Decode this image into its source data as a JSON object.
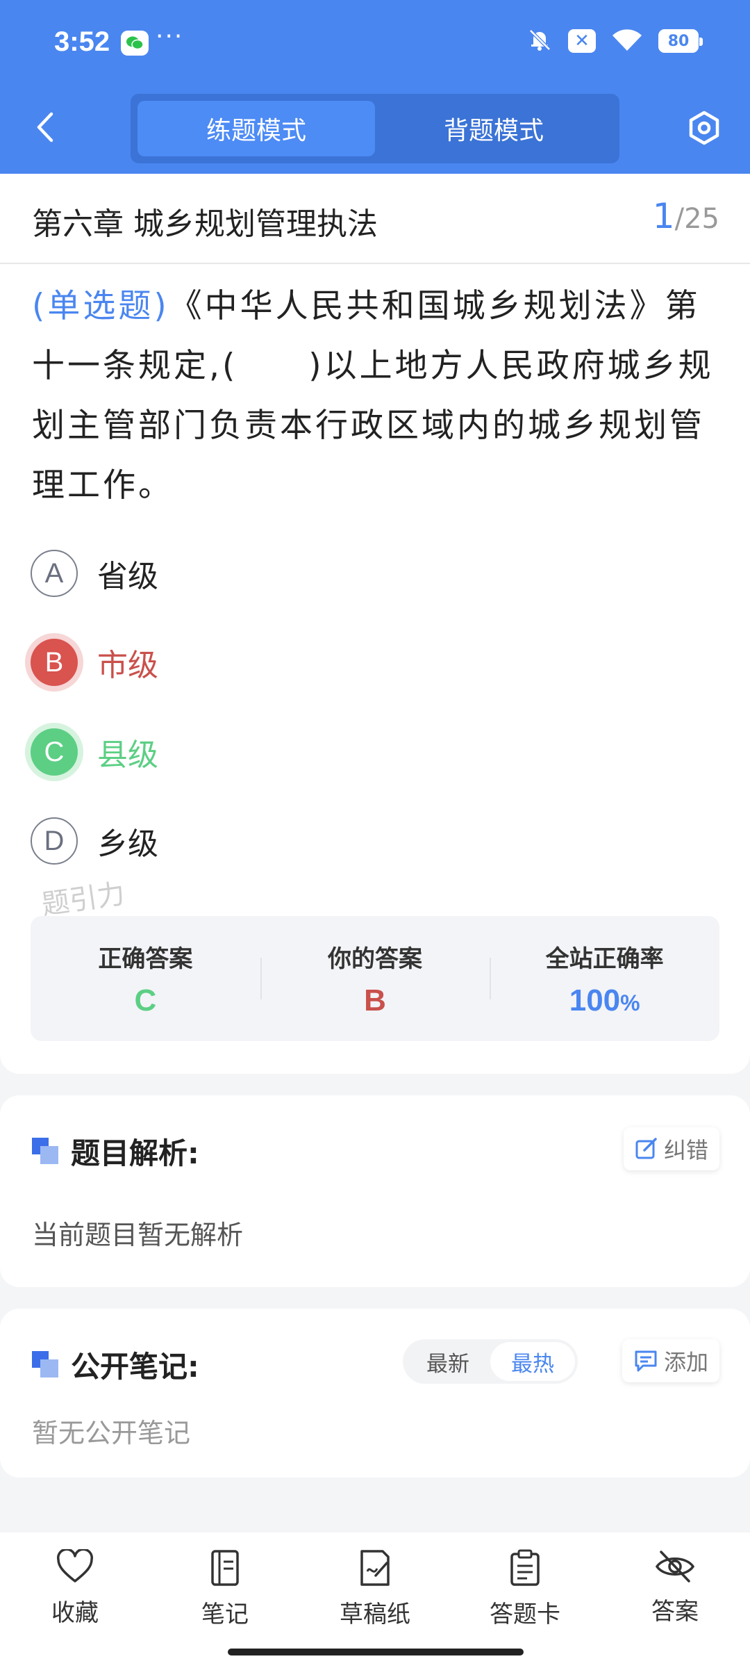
{
  "status": {
    "time": "3:52",
    "dots": "···",
    "battery": "80"
  },
  "nav": {
    "modes": [
      "练题模式",
      "背题模式"
    ],
    "active_mode": "练题模式"
  },
  "chapter": {
    "title": "第六章 城乡规划管理执法",
    "current": "1",
    "separator": "/",
    "total": "25"
  },
  "question": {
    "type_label": "(单选题)",
    "text": "《中华人民共和国城乡规划法》第十一条规定,(　　)以上地方人民政府城乡规划主管部门负责本行政区域内的城乡规划管理工作。",
    "options": [
      {
        "letter": "A",
        "text": "省级",
        "state": "none"
      },
      {
        "letter": "B",
        "text": "市级",
        "state": "wrong"
      },
      {
        "letter": "C",
        "text": "县级",
        "state": "correct"
      },
      {
        "letter": "D",
        "text": "乡级",
        "state": "none"
      }
    ]
  },
  "watermark": "题引力",
  "answer_summary": {
    "correct_label": "正确答案",
    "correct_value": "C",
    "yours_label": "你的答案",
    "yours_value": "B",
    "rate_label": "全站正确率",
    "rate_value": "100",
    "rate_unit": "%"
  },
  "analysis": {
    "title": "题目解析:",
    "correct_button": "纠错",
    "body": "当前题目暂无解析"
  },
  "notes": {
    "title": "公开笔记:",
    "sort_options": [
      "最新",
      "最热"
    ],
    "sort_active": "最热",
    "add_button": "添加",
    "empty": "暂无公开笔记"
  },
  "bottom_bar": {
    "items": [
      "收藏",
      "笔记",
      "草稿纸",
      "答题卡",
      "答案"
    ]
  },
  "colors": {
    "primary": "#4a86f0",
    "wrong": "#c9504b",
    "correct": "#5ccf84"
  }
}
